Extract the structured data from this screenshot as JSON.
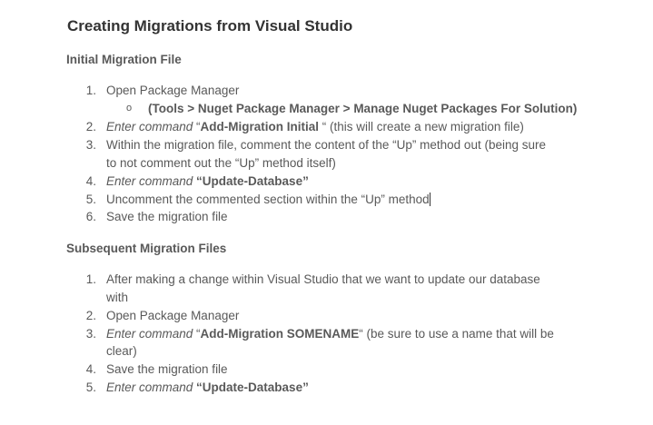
{
  "title": "Creating Migrations from Visual Studio",
  "sections": [
    {
      "heading": "Initial Migration File",
      "items": [
        {
          "num": "1.",
          "text": "Open Package Manager",
          "sub": "(Tools > Nuget Package Manager > Manage Nuget Packages For Solution)",
          "sub_bullet": "o"
        },
        {
          "num": "2.",
          "pre": "Enter command",
          "q_open": " “",
          "cmd": "Add-Migration Initial",
          "q_close": " “",
          "post": " (this will create a new migration file)"
        },
        {
          "num": "3.",
          "line1": "Within the migration file, comment the content of the “Up” method out (being sure",
          "line2": "to not comment out the “Up” method itself)"
        },
        {
          "num": "4.",
          "pre": "Enter command",
          "cmd": " “Update-Database”"
        },
        {
          "num": "5.",
          "text": "Uncomment the commented section within the “Up” method"
        },
        {
          "num": "6.",
          "text": "Save the migration file"
        }
      ]
    },
    {
      "heading": "Subsequent Migration Files",
      "items": [
        {
          "num": "1.",
          "line1": "After making a change within Visual Studio that we want to update our database",
          "line2": "with"
        },
        {
          "num": "2.",
          "text": "Open Package Manager"
        },
        {
          "num": "3.",
          "pre": "Enter command",
          "q_open": " “",
          "cmd": "Add-Migration SOMENAME",
          "q_close": "“",
          "post": " (be sure to use a name that will be",
          "line2": "clear)"
        },
        {
          "num": "4.",
          "text": "Save the migration file"
        },
        {
          "num": "5.",
          "pre": "Enter command",
          "cmd": " “Update-Database”"
        }
      ]
    }
  ]
}
